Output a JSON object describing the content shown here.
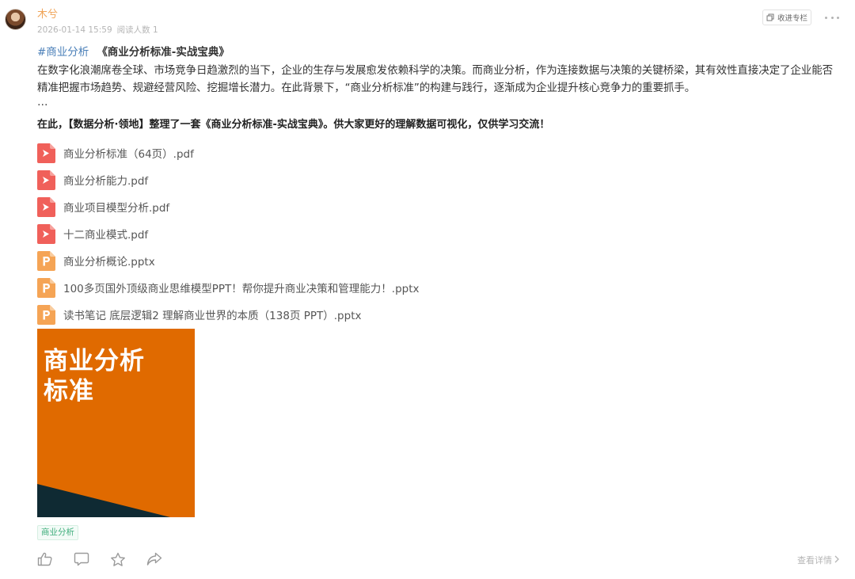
{
  "author": {
    "name": "木兮",
    "datetime": "2026-01-14 15:59",
    "reads": "阅读人数 1"
  },
  "header": {
    "collect_label": "收进专栏",
    "collect_icon": "bookmark-stack-icon",
    "more_icon": "more-dots-icon"
  },
  "post": {
    "hashtag": "#商业分析",
    "title": "《商业分析标准-实战宝典》",
    "paragraph": "在数字化浪潮席卷全球、市场竞争日趋激烈的当下，企业的生存与发展愈发依赖科学的决策。而商业分析，作为连接数据与决策的关键桥梁，其有效性直接决定了企业能否精准把握市场趋势、规避经营风险、挖掘增长潜力。在此背景下，“商业分析标准”的构建与践行，逐渐成为企业提升核心竞争力的重要抓手。",
    "ellipsis": "…",
    "bold_line": "在此，【数据分析·领地】整理了一套《商业分析标准-实战宝典》。供大家更好的理解数据可视化，仅供学习交流！"
  },
  "files": [
    {
      "name": "商业分析标准（64页）.pdf",
      "type": "pdf"
    },
    {
      "name": "商业分析能力.pdf",
      "type": "pdf"
    },
    {
      "name": "商业项目模型分析.pdf",
      "type": "pdf"
    },
    {
      "name": "十二商业模式.pdf",
      "type": "pdf"
    },
    {
      "name": "商业分析概论.pptx",
      "type": "pptx"
    },
    {
      "name": "100多页国外顶级商业思维模型PPT！帮你提升商业决策和管理能力！.pptx",
      "type": "pptx"
    },
    {
      "name": "读书笔记 底层逻辑2 理解商业世界的本质（138页 PPT）.pptx",
      "type": "pptx"
    }
  ],
  "cover": {
    "line1": "商业分析",
    "line2": "标准"
  },
  "tag": "商业分析",
  "actions": {
    "like_icon": "thumbs-up-icon",
    "comment_icon": "comment-icon",
    "favorite_icon": "star-icon",
    "share_icon": "share-icon"
  },
  "detail_label": "查看详情",
  "colors": {
    "author": "#f0a458",
    "hashtag": "#4a7fb8",
    "pdf_icon": "#f0605a",
    "pptx_icon": "#f5a455",
    "cover_orange": "#e06a00",
    "cover_dark": "#0f2a33",
    "tag_green": "#3fae7c"
  }
}
